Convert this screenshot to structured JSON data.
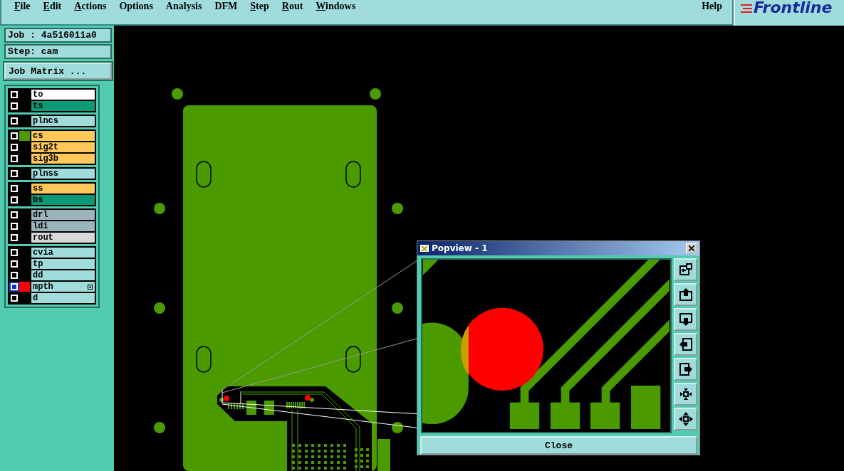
{
  "menu": [
    {
      "label": "File",
      "underline_first": true
    },
    {
      "label": "Edit",
      "underline_first": true
    },
    {
      "label": "Actions",
      "underline_first": true
    },
    {
      "label": "Options",
      "underline_first": false
    },
    {
      "label": "Analysis",
      "underline_first": false
    },
    {
      "label": "DFM",
      "underline_first": false
    },
    {
      "label": "Step",
      "underline_first": true
    },
    {
      "label": "Rout",
      "underline_first": true
    },
    {
      "label": "Windows",
      "underline_first": true
    }
  ],
  "help": "Help",
  "logo": "Frontline",
  "job": "Job : 4a516011a0",
  "step": "Step: cam",
  "job_matrix_button": "Job Matrix ...",
  "layer_groups": [
    {
      "layers": [
        {
          "name": "to",
          "color": "#ffffff",
          "selected": false,
          "expandable": false
        },
        {
          "name": "ts",
          "color": "#0a9a78",
          "selected": false,
          "expandable": false
        }
      ]
    },
    {
      "layers": [
        {
          "name": "plncs",
          "color": "#a0dcdc",
          "selected": false,
          "expandable": false
        }
      ]
    },
    {
      "layers": [
        {
          "name": "cs",
          "color": "#ffc858",
          "swatch": {
            "color": "#4a9a00"
          },
          "selected": false,
          "expandable": false
        },
        {
          "name": "sig2t",
          "color": "#ffc858",
          "selected": false,
          "expandable": false
        },
        {
          "name": "sig3b",
          "color": "#ffc858",
          "selected": false,
          "expandable": false
        }
      ]
    },
    {
      "layers": [
        {
          "name": "plnss",
          "color": "#a0dcdc",
          "selected": false,
          "expandable": false
        }
      ]
    },
    {
      "layers": [
        {
          "name": "ss",
          "color": "#ffc858",
          "selected": false,
          "expandable": false
        },
        {
          "name": "bs",
          "color": "#0a9a78",
          "selected": false,
          "expandable": false
        }
      ]
    },
    {
      "layers": [
        {
          "name": "drl",
          "color": "#9cb4bc",
          "selected": false,
          "expandable": false
        },
        {
          "name": "ldi",
          "color": "#9cb4bc",
          "selected": false,
          "expandable": false
        },
        {
          "name": "rout",
          "color": "#d8d8d8",
          "selected": false,
          "expandable": false
        }
      ]
    },
    {
      "layers": [
        {
          "name": "cvia",
          "color": "#a0dcdc",
          "selected": false,
          "expandable": false
        },
        {
          "name": "tp",
          "color": "#a0dcdc",
          "selected": false,
          "expandable": false
        },
        {
          "name": "dd",
          "color": "#a0dcdc",
          "selected": false,
          "expandable": false
        },
        {
          "name": "mpth",
          "color": "#a0dcdc",
          "swatch": {
            "color": "#ff0000"
          },
          "selected": true,
          "expandable": true
        },
        {
          "name": "d",
          "color": "#a0dcdc",
          "selected": false,
          "expandable": false
        }
      ]
    }
  ],
  "popview": {
    "title": "Popview - 1",
    "close_button": "Close"
  }
}
